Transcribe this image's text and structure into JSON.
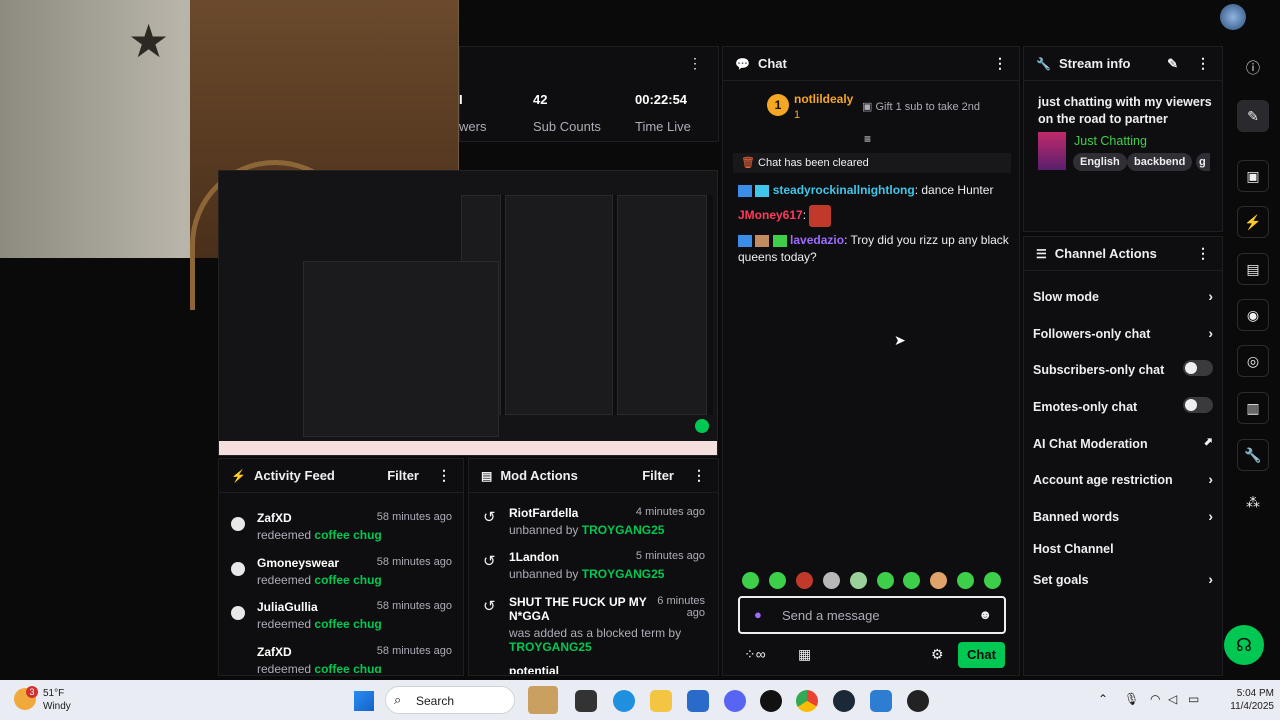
{
  "stats": {
    "partial_label": "wers",
    "sub_count_value": "42",
    "sub_count_label": "Sub Counts",
    "time_live_value": "00:22:54",
    "time_live_label": "Time Live"
  },
  "chat": {
    "title": "Chat",
    "leader_rank": "1",
    "leader_name": "notlildealy",
    "leader_count": "1",
    "gift_text": "Gift 1 sub to take 2nd",
    "cleared_text": "Chat has been cleared",
    "messages": [
      {
        "user": "steadyrockinallnightlong",
        "text": ": dance Hunter",
        "color": "#3fc6e8"
      },
      {
        "user": "JMoney617",
        "text": ":",
        "color": "#ff3b5c"
      },
      {
        "user": "lavedazio",
        "text": ": Troy did you rizz up any black queens today?",
        "color": "#9e6bff"
      }
    ],
    "input_placeholder": "Send a message",
    "send_label": "Chat"
  },
  "stream_info": {
    "title": "Stream info",
    "stream_title": "just chatting with my viewers on the road to partner",
    "category": "Just Chatting",
    "tags": [
      "English",
      "backbend",
      "g"
    ]
  },
  "channel_actions": {
    "title": "Channel Actions",
    "items": [
      {
        "label": "Slow mode",
        "kind": "chevron"
      },
      {
        "label": "Followers-only chat",
        "kind": "chevron"
      },
      {
        "label": "Subscribers-only chat",
        "kind": "toggle"
      },
      {
        "label": "Emotes-only chat",
        "kind": "toggle"
      },
      {
        "label": "AI Chat Moderation",
        "kind": "external"
      },
      {
        "label": "Account age restriction",
        "kind": "chevron"
      },
      {
        "label": "Banned words",
        "kind": "chevron"
      },
      {
        "label": "Host Channel",
        "kind": "none"
      },
      {
        "label": "Set goals",
        "kind": "chevron"
      }
    ]
  },
  "activity_feed": {
    "title": "Activity Feed",
    "filter_label": "Filter",
    "items": [
      {
        "user": "ZafXD",
        "time": "58 minutes ago",
        "action": "redeemed",
        "reward": "coffee chug"
      },
      {
        "user": "Gmoneyswear",
        "time": "58 minutes ago",
        "action": "redeemed",
        "reward": "coffee chug"
      },
      {
        "user": "JuliaGullia",
        "time": "58 minutes ago",
        "action": "redeemed",
        "reward": "coffee chug"
      },
      {
        "user": "ZafXD",
        "time": "58 minutes ago",
        "action": "redeemed",
        "reward": "coffee chug"
      }
    ]
  },
  "mod_actions": {
    "title": "Mod Actions",
    "filter_label": "Filter",
    "items": [
      {
        "target": "RiotFardella",
        "time": "4 minutes ago",
        "detail": "unbanned by",
        "mod": "TROYGANG25"
      },
      {
        "target": "1Landon",
        "time": "5 minutes ago",
        "detail": "unbanned by",
        "mod": "TROYGANG25"
      },
      {
        "target": "SHUT THE FUCK UP MY N*GGA",
        "time": "6 minutes ago",
        "detail": "was added as a blocked term by",
        "mod": "TROYGANG25"
      },
      {
        "target": "potential",
        "time": "",
        "detail": "",
        "mod": ""
      }
    ]
  },
  "taskbar": {
    "weather_temp": "51°F",
    "weather_desc": "Windy",
    "weather_badge": "3",
    "search_label": "Search",
    "time": "5:04 PM",
    "date": "11/4/2025"
  },
  "colors": {
    "accent_green": "#00c853",
    "leader_gold": "#f5a623",
    "panel_bg": "#0e0e10"
  }
}
